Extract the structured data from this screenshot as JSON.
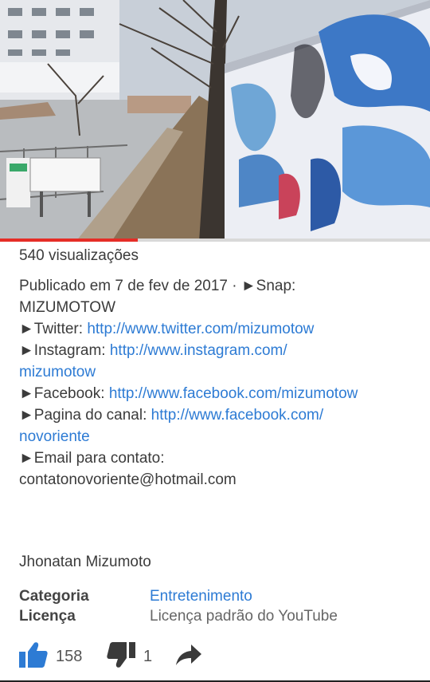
{
  "video": {
    "progress_fraction": 0.32
  },
  "info": {
    "views": "540 visualizações",
    "description_lines": [
      [
        {
          "text": "Publicado em 7 de fev de 2017 · ►Snap:",
          "link": false
        }
      ],
      [
        {
          "text": "MIZUMOTOW",
          "link": false
        }
      ],
      [
        {
          "text": "►Twitter: ",
          "link": false
        },
        {
          "text": "http://www.twitter.com/mizumotow",
          "link": true
        }
      ],
      [
        {
          "text": "►Instagram: ",
          "link": false
        },
        {
          "text": "http://www.instagram.com/",
          "link": true
        }
      ],
      [
        {
          "text": "mizumotow",
          "link": true
        }
      ],
      [
        {
          "text": "►Facebook: ",
          "link": false
        },
        {
          "text": "http://www.facebook.com/mizumotow",
          "link": true
        }
      ],
      [
        {
          "text": "►Pagina do canal: ",
          "link": false
        },
        {
          "text": "http://www.facebook.com/",
          "link": true
        }
      ],
      [
        {
          "text": "novoriente",
          "link": true
        }
      ],
      [
        {
          "text": "►Email para contato:",
          "link": false
        }
      ],
      [
        {
          "text": "contatonovoriente@hotmail.com",
          "link": false
        }
      ]
    ],
    "author": "Jhonatan Mizumoto",
    "category_label": "Categoria",
    "category_value": "Entretenimento",
    "license_label": "Licença",
    "license_value": "Licença padrão do YouTube"
  },
  "actions": {
    "like_count": "158",
    "dislike_count": "1"
  },
  "colors": {
    "accent_link": "#2d7bd4",
    "like_blue": "#2d7bd4",
    "progress_red": "#e52d27"
  }
}
